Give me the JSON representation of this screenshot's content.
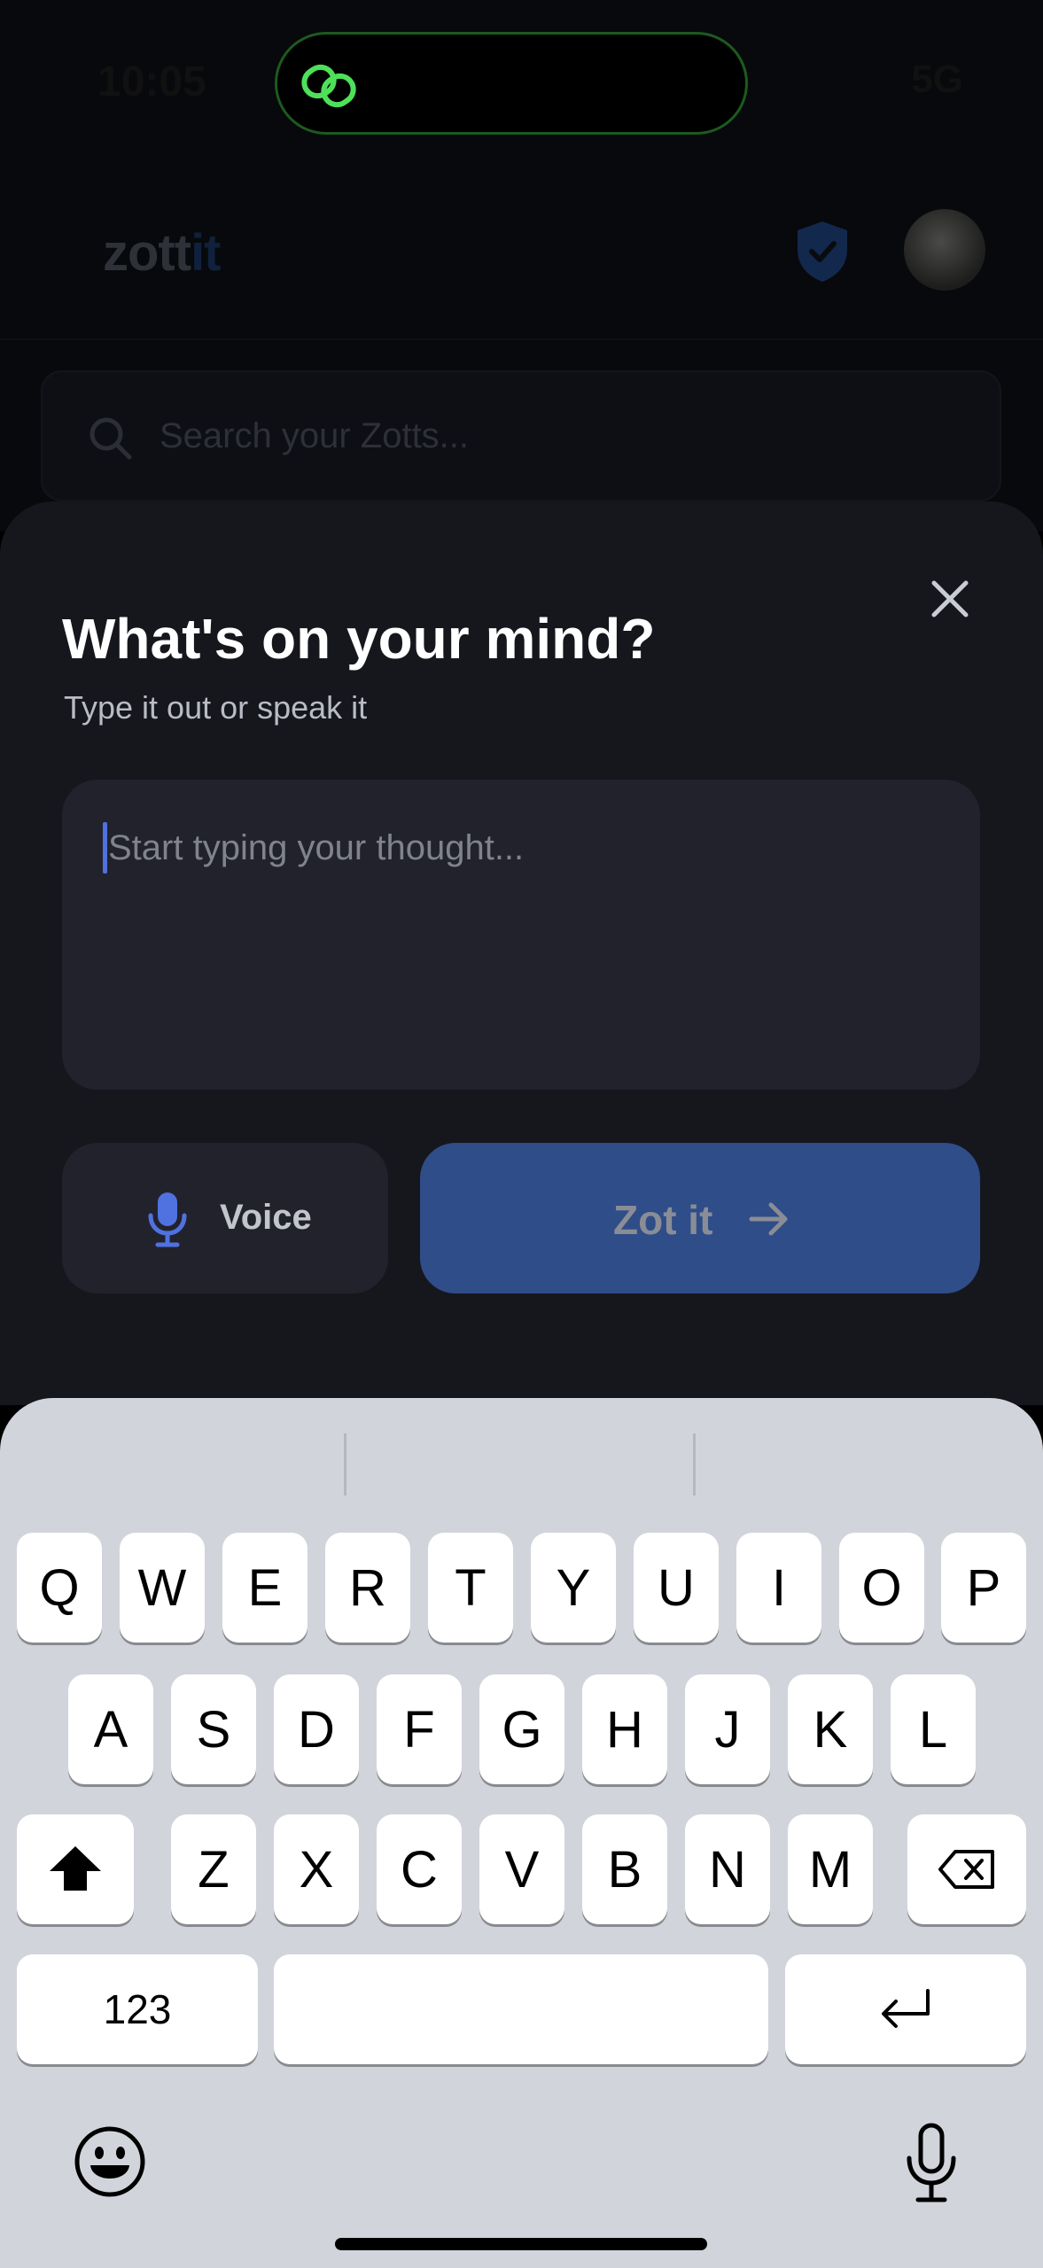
{
  "status_bar": {
    "time": "10:05",
    "right": "5G"
  },
  "header": {
    "logo_prefix": "zott",
    "logo_suffix": "it"
  },
  "search": {
    "placeholder": "Search your Zotts..."
  },
  "sheet": {
    "title": "What's on your mind?",
    "subtitle": "Type it out or speak it",
    "input_placeholder": "Start typing your thought...",
    "input_value": "",
    "voice_label": "Voice",
    "submit_label": "Zot it"
  },
  "keyboard": {
    "row1": [
      "Q",
      "W",
      "E",
      "R",
      "T",
      "Y",
      "U",
      "I",
      "O",
      "P"
    ],
    "row2": [
      "A",
      "S",
      "D",
      "F",
      "G",
      "H",
      "J",
      "K",
      "L"
    ],
    "row3": [
      "Z",
      "X",
      "C",
      "V",
      "B",
      "N",
      "M"
    ],
    "numbers_label": "123",
    "space_label": ""
  },
  "colors": {
    "accent": "#4f72e0",
    "submit_bg": "#2f4d88",
    "island_ring": "#1d5a1f",
    "island_icon": "#4ee05a"
  },
  "icons": [
    "link-icon",
    "shield-check-icon",
    "search-icon",
    "close-icon",
    "mic-icon",
    "arrow-right-icon",
    "shift-icon",
    "backspace-icon",
    "return-icon",
    "emoji-icon",
    "dictation-mic-icon"
  ]
}
